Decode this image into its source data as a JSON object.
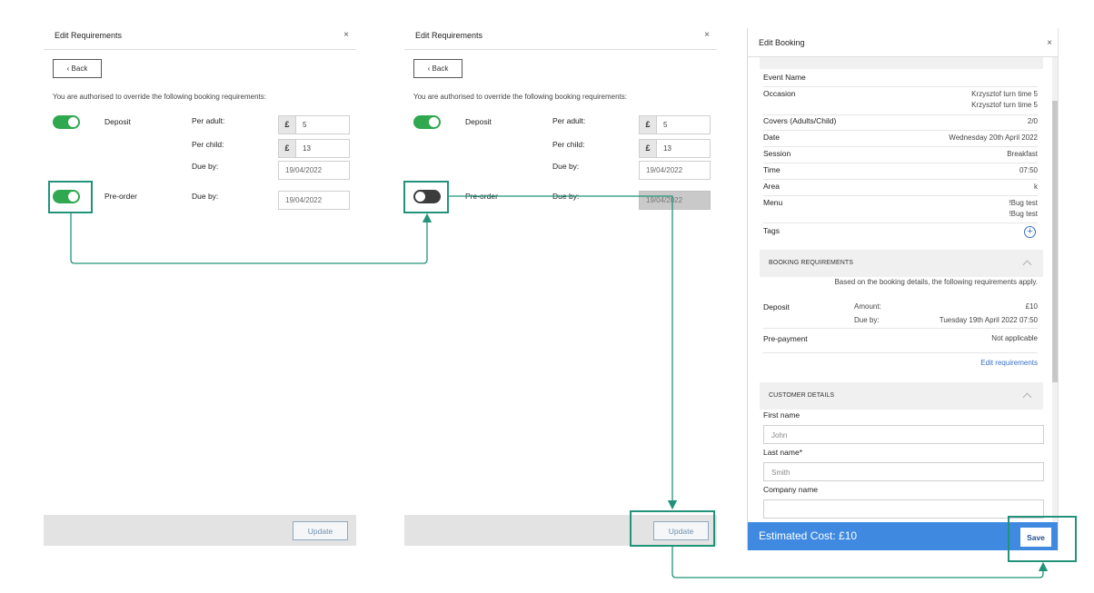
{
  "requirements": {
    "title": "Edit Requirements",
    "close": "×",
    "back": "‹ Back",
    "intro": "You are authorised to override the following booking requirements:",
    "deposit_label": "Deposit",
    "per_adult_label": "Per adult:",
    "per_child_label": "Per child:",
    "due_by_label": "Due by:",
    "preorder_label": "Pre-order",
    "currency": "£",
    "update": "Update",
    "before": {
      "deposit_on": true,
      "per_adult": "5",
      "per_child": "13",
      "deposit_due": "19/04/2022",
      "preorder_on": true,
      "preorder_due": "19/04/2022"
    },
    "after": {
      "deposit_on": true,
      "per_adult": "5",
      "per_child": "13",
      "deposit_due": "19/04/2022",
      "preorder_on": false,
      "preorder_due": "19/04/2022"
    }
  },
  "booking": {
    "title": "Edit Booking",
    "close": "×",
    "details": [
      {
        "key": "Event Name",
        "value": ""
      },
      {
        "key": "Occasion",
        "value": "Krzysztof turn time 5",
        "value2": "Krzysztof turn time 5"
      },
      {
        "key": "Covers (Adults/Child)",
        "value": "2/0"
      },
      {
        "key": "Date",
        "value": "Wednesday 20th April 2022"
      },
      {
        "key": "Session",
        "value": "Breakfast"
      },
      {
        "key": "Time",
        "value": "07:50"
      },
      {
        "key": "Area",
        "value": "k"
      },
      {
        "key": "Menu",
        "value": "!Bug test",
        "value2": "!Bug test"
      },
      {
        "key": "Tags",
        "value": ""
      }
    ],
    "requirements_section": {
      "title": "BOOKING REQUIREMENTS",
      "note": "Based on the booking details, the following requirements apply.",
      "deposit_label": "Deposit",
      "amount_label": "Amount:",
      "amount_value": "£10",
      "due_label": "Due by:",
      "due_value": "Tuesday 19th April 2022 07:50",
      "prepayment_label": "Pre-payment",
      "prepayment_value": "Not applicable",
      "edit_link": "Edit requirements"
    },
    "customer_section": {
      "title": "CUSTOMER DETAILS",
      "first_name_label": "First name",
      "first_name_placeholder": "John",
      "last_name_label": "Last name*",
      "last_name_placeholder": "Smith",
      "company_label": "Company name",
      "company_placeholder": ""
    },
    "estimated_cost": "Estimated Cost: £10",
    "save": "Save"
  },
  "colors": {
    "toggle_on": "#2fa84f",
    "toggle_off": "#3c3c3c",
    "annotation": "#21937a",
    "footer_blue": "#3f8ae0",
    "link_blue": "#3a6fc4"
  },
  "icons": [
    "close-icon",
    "back-chevron-icon",
    "toggle-icon",
    "add-tag-icon",
    "collapse-chevron-icon"
  ]
}
